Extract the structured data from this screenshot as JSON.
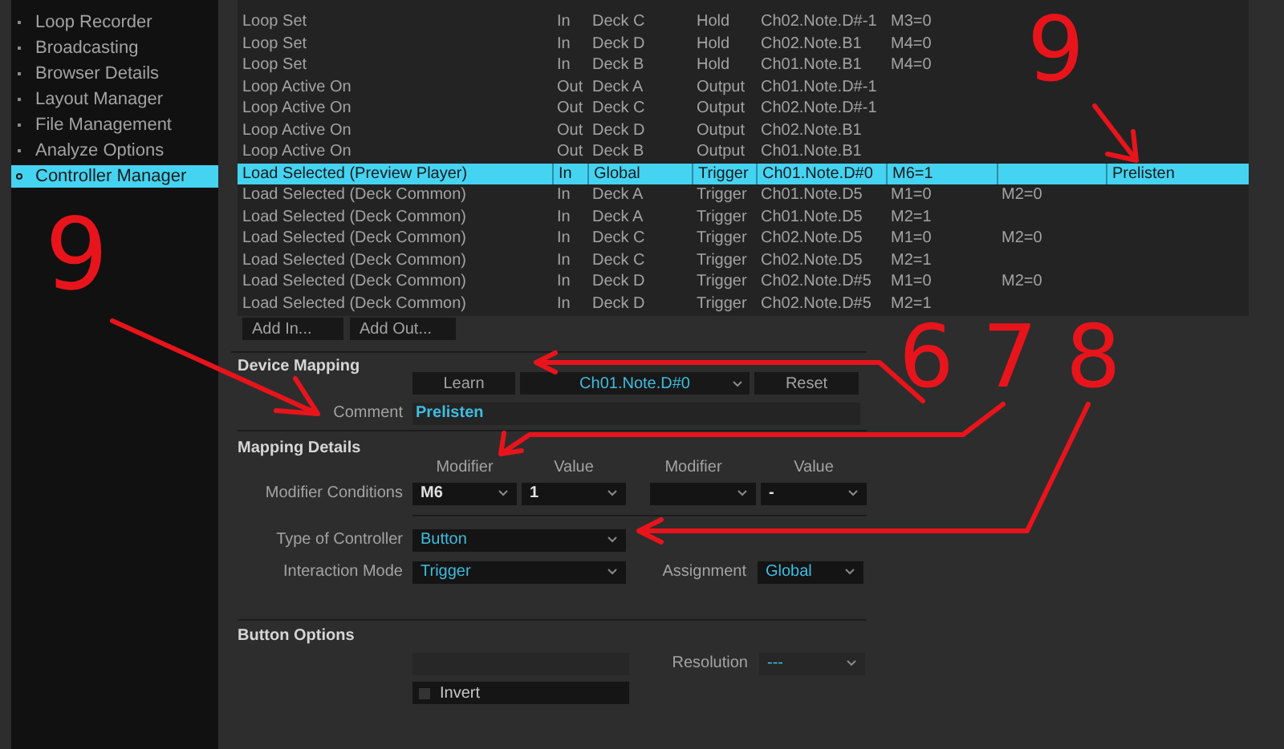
{
  "sidebar": {
    "items": [
      {
        "label": "Loop Recorder",
        "selected": false
      },
      {
        "label": "Broadcasting",
        "selected": false
      },
      {
        "label": "Browser Details",
        "selected": false
      },
      {
        "label": "Layout Manager",
        "selected": false
      },
      {
        "label": "File Management",
        "selected": false
      },
      {
        "label": "Analyze Options",
        "selected": false
      },
      {
        "label": "Controller Manager",
        "selected": true
      }
    ]
  },
  "table": {
    "rows": [
      {
        "cells": [
          "Loop Set",
          "In",
          "Deck C",
          "Hold",
          "Ch02.Note.D#-1",
          "M3=0",
          "",
          ""
        ],
        "selected": false
      },
      {
        "cells": [
          "Loop Set",
          "In",
          "Deck D",
          "Hold",
          "Ch02.Note.B1",
          "M4=0",
          "",
          ""
        ],
        "selected": false
      },
      {
        "cells": [
          "Loop Set",
          "In",
          "Deck B",
          "Hold",
          "Ch01.Note.B1",
          "M4=0",
          "",
          ""
        ],
        "selected": false
      },
      {
        "cells": [
          "Loop Active On",
          "Out",
          "Deck A",
          "Output",
          "Ch01.Note.D#-1",
          "",
          "",
          ""
        ],
        "selected": false
      },
      {
        "cells": [
          "Loop Active On",
          "Out",
          "Deck C",
          "Output",
          "Ch02.Note.D#-1",
          "",
          "",
          ""
        ],
        "selected": false
      },
      {
        "cells": [
          "Loop Active On",
          "Out",
          "Deck D",
          "Output",
          "Ch02.Note.B1",
          "",
          "",
          ""
        ],
        "selected": false
      },
      {
        "cells": [
          "Loop Active On",
          "Out",
          "Deck B",
          "Output",
          "Ch01.Note.B1",
          "",
          "",
          ""
        ],
        "selected": false
      },
      {
        "cells": [
          "Load Selected (Preview Player)",
          "In",
          "Global",
          "Trigger",
          "Ch01.Note.D#0",
          "M6=1",
          "",
          "Prelisten"
        ],
        "selected": true
      },
      {
        "cells": [
          "Load Selected (Deck Common)",
          "In",
          "Deck A",
          "Trigger",
          "Ch01.Note.D5",
          "M1=0",
          "M2=0",
          ""
        ],
        "selected": false
      },
      {
        "cells": [
          "Load Selected (Deck Common)",
          "In",
          "Deck A",
          "Trigger",
          "Ch01.Note.D5",
          "M2=1",
          "",
          ""
        ],
        "selected": false
      },
      {
        "cells": [
          "Load Selected (Deck Common)",
          "In",
          "Deck C",
          "Trigger",
          "Ch02.Note.D5",
          "M1=0",
          "M2=0",
          ""
        ],
        "selected": false
      },
      {
        "cells": [
          "Load Selected (Deck Common)",
          "In",
          "Deck C",
          "Trigger",
          "Ch02.Note.D5",
          "M2=1",
          "",
          ""
        ],
        "selected": false
      },
      {
        "cells": [
          "Load Selected (Deck Common)",
          "In",
          "Deck D",
          "Trigger",
          "Ch02.Note.D#5",
          "M1=0",
          "M2=0",
          ""
        ],
        "selected": false
      },
      {
        "cells": [
          "Load Selected (Deck Common)",
          "In",
          "Deck D",
          "Trigger",
          "Ch02.Note.D#5",
          "M2=1",
          "",
          ""
        ],
        "selected": false
      }
    ]
  },
  "table_buttons": [
    "Add In...",
    "Add Out..."
  ],
  "device_mapping": {
    "title": "Device Mapping",
    "learn": "Learn",
    "note": "Ch01.Note.D#0",
    "reset": "Reset",
    "comment_label": "Comment",
    "comment": "Prelisten"
  },
  "mapping_details": {
    "title": "Mapping Details",
    "headers": [
      "Modifier",
      "Value",
      "Modifier",
      "Value"
    ],
    "modifier_label": "Modifier Conditions",
    "modifiers": [
      {
        "modifier": "M6",
        "value": "1"
      },
      {
        "value": "-"
      }
    ],
    "type_label": "Type of Controller",
    "type": "Button",
    "mode_label": "Interaction Mode",
    "mode": "Trigger",
    "assignment_label": "Assignment",
    "assignment": "Global"
  },
  "button_options": {
    "title": "Button Options",
    "resolution_label": "Resolution",
    "resolution": "---",
    "invert_label": "Invert",
    "invert_checked": false
  },
  "annotations": [
    {
      "label": "9"
    },
    {
      "label": "9"
    },
    {
      "label": "6"
    },
    {
      "label": "7"
    },
    {
      "label": "8"
    }
  ]
}
